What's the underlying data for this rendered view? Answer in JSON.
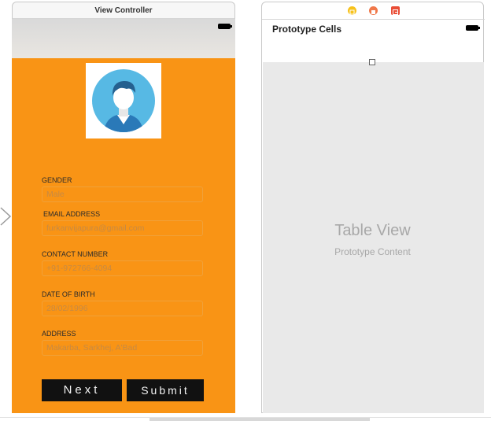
{
  "left_scene": {
    "title": "View Controller",
    "fields": [
      {
        "label": "GENDER",
        "value": "Male"
      },
      {
        "label": "EMAIL ADDRESS",
        "value": "furkanvijapura@gmail.com"
      },
      {
        "label": "CONTACT NUMBER",
        "value": "+91-972766-4094"
      },
      {
        "label": "DATE OF BIRTH",
        "value": "28/02/1996"
      },
      {
        "label": "ADDRESS",
        "value": "Makarba, Sarkhej, A'Bad"
      }
    ],
    "buttons": {
      "next": "Next",
      "submit": "Submit"
    },
    "background_color": "#f99415"
  },
  "right_scene": {
    "dock_icons": [
      "view-controller-icon",
      "first-responder-icon",
      "exit-icon"
    ],
    "header": "Prototype Cells",
    "table_view_title": "Table View",
    "table_view_subtitle": "Prototype Content"
  },
  "icons": {
    "avatar": "user-avatar-icon",
    "entry_arrow": "entry-point-arrow-icon",
    "battery": "battery-icon"
  }
}
